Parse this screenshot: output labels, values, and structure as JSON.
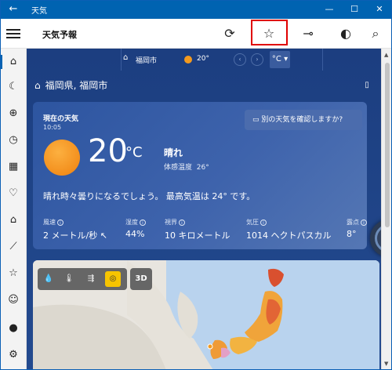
{
  "window": {
    "title": "天気",
    "back_icon": "←",
    "minimize": "—",
    "maximize": "☐",
    "close": "✕"
  },
  "toolbar": {
    "app_name": "天気予報",
    "refresh_icon": "⟳",
    "favorite_icon": "☆",
    "pin_icon": "⊸",
    "dark_mode_icon": "◐",
    "search_icon": "⌕"
  },
  "location_bar": {
    "home_icon": "⌂",
    "city": "福岡市",
    "temp": "20°",
    "prev": "‹",
    "next": "›",
    "unit": "°C ▾"
  },
  "region_title": "福岡県, 福岡市",
  "current": {
    "label": "現在の天気",
    "time": "10:05",
    "feedback_button": "別の天気を確認しますか?",
    "temperature": "20",
    "unit": "°C",
    "condition": "晴れ",
    "feels_like_label": "体感温度",
    "feels_like_value": "26°",
    "summary": "晴れ時々曇りになるでしょう。 最高気温は 24° です。",
    "metrics": [
      {
        "label": "風速",
        "value": "2 メートル/秒 ↖"
      },
      {
        "label": "湿度",
        "value": "44%"
      },
      {
        "label": "視界",
        "value": "10 キロメートル"
      },
      {
        "label": "気圧",
        "value": "1014 ヘクトパスカル"
      },
      {
        "label": "露点",
        "value": "8°"
      }
    ]
  },
  "map": {
    "tools": [
      "💧",
      "🌡",
      "⇶",
      "◎"
    ],
    "active_tool_index": 3,
    "three_d": "3D"
  },
  "sidebar_icons": [
    "⌂",
    "☾",
    "⊕",
    "◷",
    "▦",
    "♡",
    "⌂",
    "⟋",
    "☆",
    "☺",
    "●",
    "⚙"
  ],
  "colors": {
    "accent": "#0063b1",
    "highlight_box": "#e00000",
    "sun": "#f38f1d",
    "map_active": "#f7c400"
  }
}
